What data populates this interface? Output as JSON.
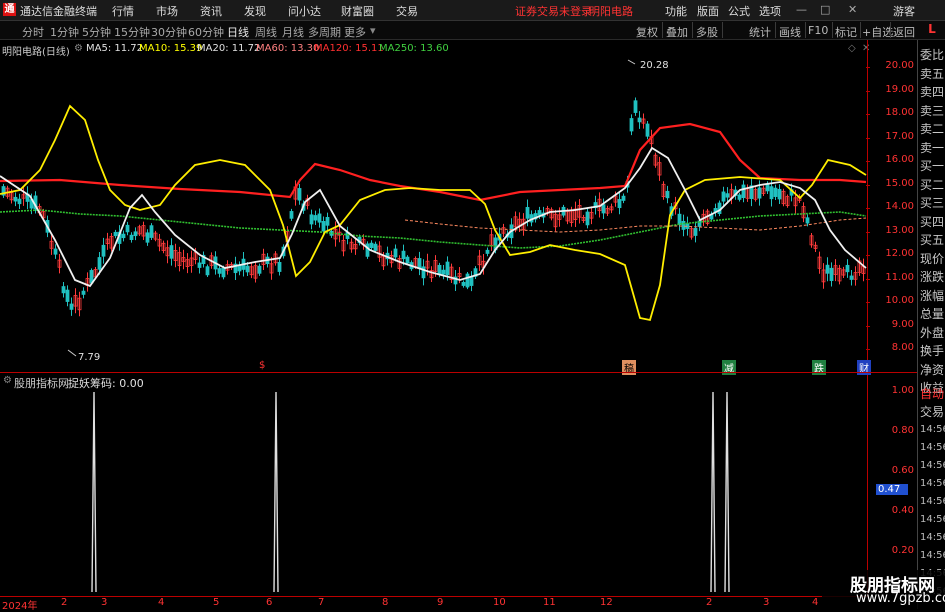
{
  "topbar": {
    "app_title": "通达信金融终端",
    "menu": [
      "行情",
      "市场",
      "资讯",
      "发现",
      "问小达",
      "财富圈",
      "交易"
    ],
    "status": "证券交易未登录",
    "stock": "明阳电路",
    "right_menu": [
      "功能",
      "版面",
      "公式",
      "选项"
    ],
    "guest": "游客"
  },
  "periodbar": {
    "periods": [
      "分时",
      "1分钟",
      "5分钟",
      "15分钟",
      "30分钟",
      "60分钟",
      "日线",
      "周线",
      "月线",
      "多周期",
      "更多"
    ],
    "active": "日线",
    "tools": [
      "复权",
      "叠加",
      "多股",
      "统计",
      "画线",
      "F10",
      "标记",
      "+自选",
      "返回"
    ],
    "side_label": "L"
  },
  "main_chart": {
    "title": "明阳电路(日线)",
    "ma": [
      {
        "label": "MA5: 11.72",
        "color": "#e0e0e0"
      },
      {
        "label": "MA10: 15.39",
        "color": "#ffff00"
      },
      {
        "label": "MA20: 11.72",
        "color": "#e0e0e0"
      },
      {
        "label": "MA60: 13.30",
        "color": "#ff8080"
      },
      {
        "label": "MA120: 15.11",
        "color": "#ff3030"
      },
      {
        "label": "MA250: 13.60",
        "color": "#40d040"
      }
    ],
    "high_label": "20.28",
    "low_label": "7.79",
    "yticks": [
      "20.00",
      "19.00",
      "18.00",
      "17.00",
      "16.00",
      "15.00",
      "14.00",
      "13.00",
      "12.00",
      "11.00",
      "10.00",
      "9.00",
      "8.00"
    ],
    "flags": [
      {
        "text": "$",
        "color": "#ff3333",
        "bg": "none"
      },
      {
        "text": "稿",
        "color": "#000",
        "bg": "#e09060"
      },
      {
        "text": "减",
        "color": "#fff",
        "bg": "#208040"
      },
      {
        "text": "跌",
        "color": "#fff",
        "bg": "#208040"
      },
      {
        "text": "财",
        "color": "#fff",
        "bg": "#2040c0"
      }
    ]
  },
  "indicator": {
    "name": "股朋指标网",
    "formula": "捉妖筹码: 0.00",
    "yticks": [
      "1.00",
      "0.80",
      "0.60",
      "0.40",
      "0.20"
    ],
    "current": "0.47",
    "chart_data": {
      "type": "line",
      "title": "捉妖筹码",
      "ylim": [
        0,
        1
      ],
      "x": [
        "2024-02",
        "2024-05",
        "2025-02",
        "2025-02"
      ],
      "values": [
        1,
        1,
        1,
        1
      ]
    }
  },
  "right_panel": {
    "labels": [
      "委比",
      "卖五",
      "卖四",
      "卖三",
      "卖二",
      "卖一",
      "买一",
      "买二",
      "买三",
      "买四",
      "买五",
      "现价",
      "涨跌",
      "涨幅",
      "总量",
      "外盘",
      "换手",
      "净资",
      "收益"
    ],
    "lower": [
      "自动",
      "交易"
    ],
    "times": [
      "14:56",
      "14:56",
      "14:56",
      "14:56",
      "14:56",
      "14:56",
      "14:56",
      "14:56",
      "14:56",
      "14:56"
    ]
  },
  "xaxis": [
    "2024年",
    "2",
    "3",
    "4",
    "5",
    "6",
    "7",
    "8",
    "9",
    "10",
    "11",
    "12",
    "2",
    "3",
    "4"
  ],
  "watermark": {
    "line1": "股朋指标网",
    "line2": "www.7gpzb.com"
  }
}
